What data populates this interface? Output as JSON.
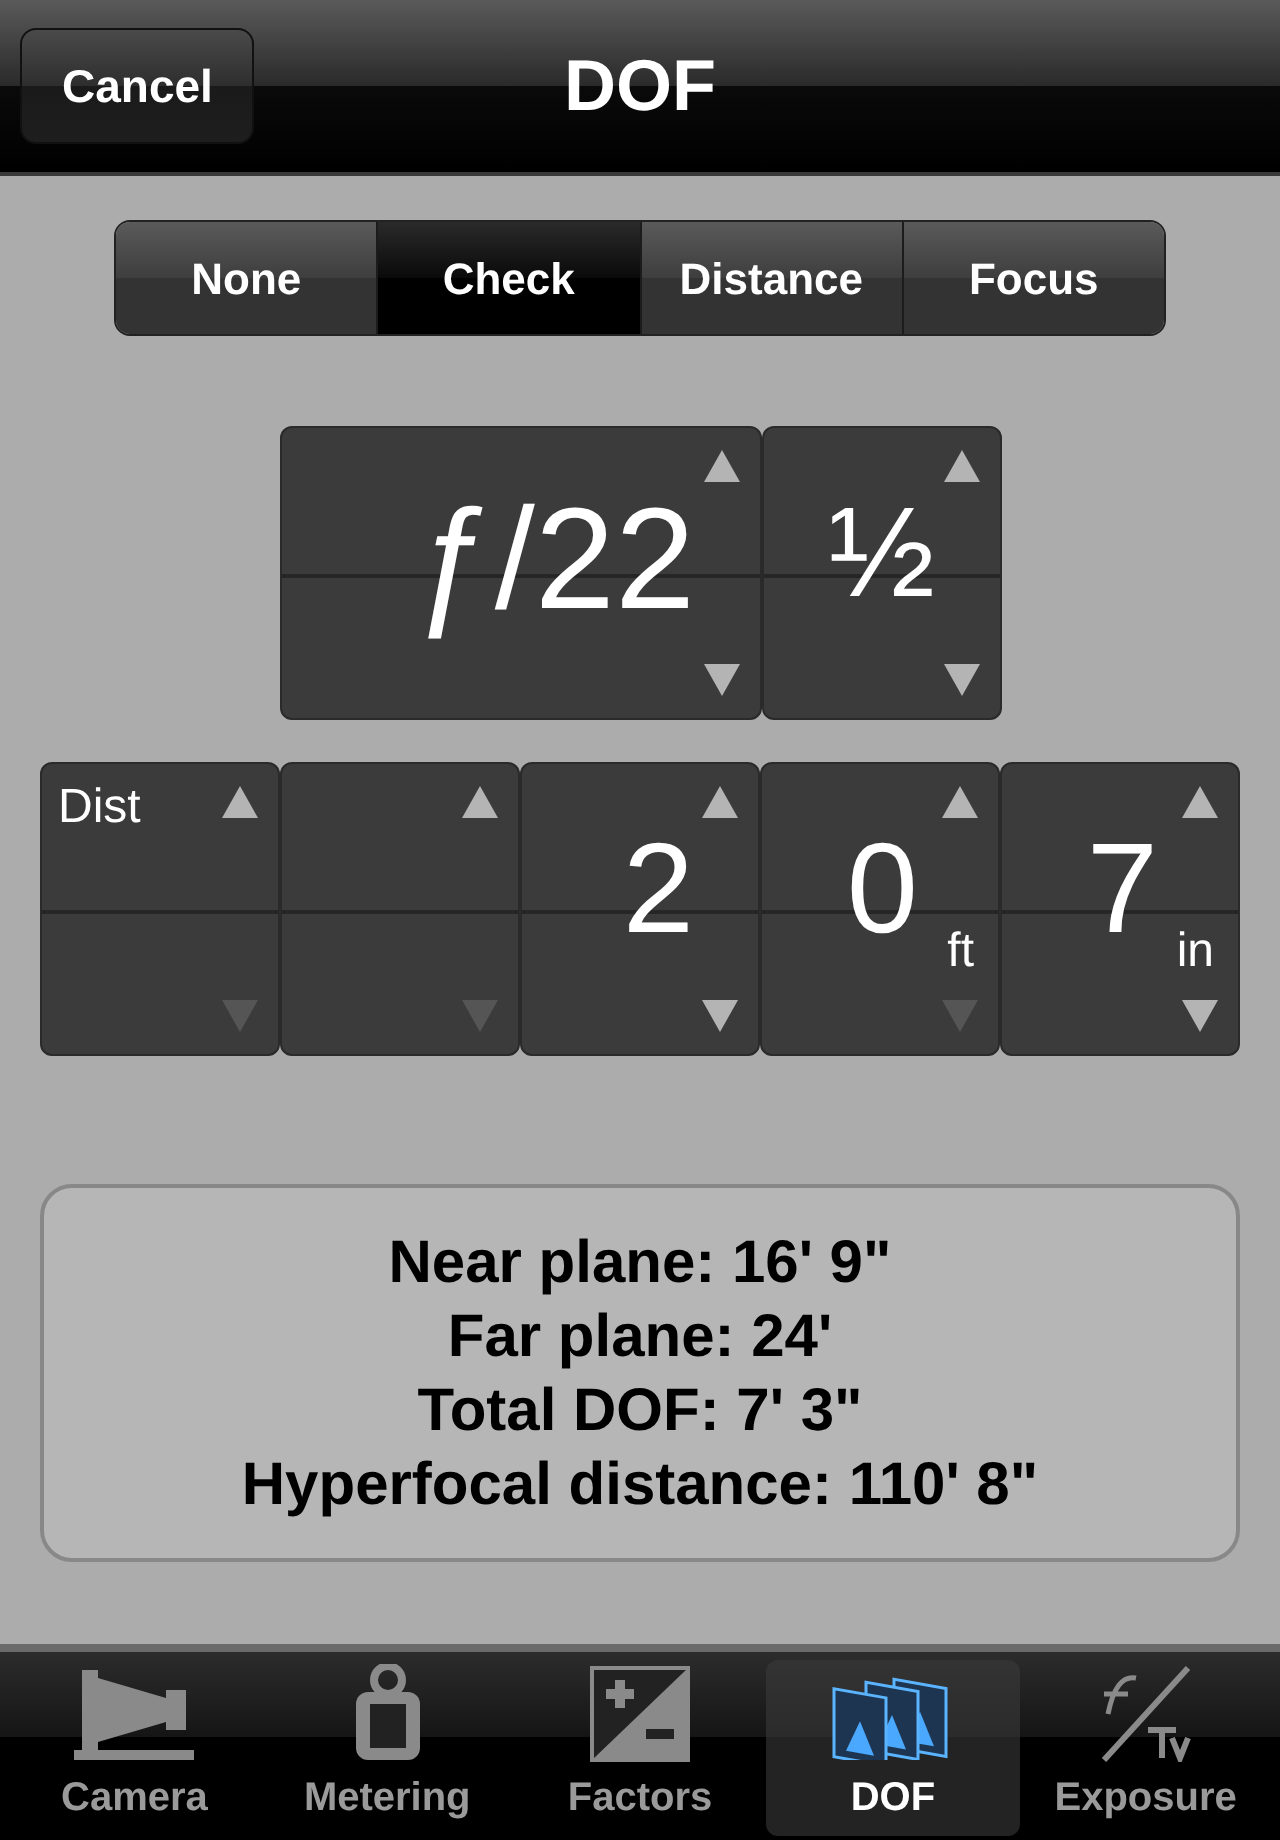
{
  "nav_bar": {
    "cancel": "Cancel",
    "title": "DOF"
  },
  "segments": [
    {
      "label": "None",
      "selected": false
    },
    {
      "label": "Check",
      "selected": true
    },
    {
      "label": "Distance",
      "selected": false
    },
    {
      "label": "Focus",
      "selected": false
    }
  ],
  "aperture_dials": [
    {
      "value": "ƒ/22",
      "up_disabled": false,
      "down_disabled": false
    },
    {
      "value": "½",
      "up_disabled": false,
      "down_disabled": false
    }
  ],
  "distance_dials": [
    {
      "label": "Dist",
      "up_disabled": false,
      "down_disabled": true
    },
    {
      "up_disabled": false,
      "down_disabled": true
    },
    {
      "value": "2",
      "up_disabled": false,
      "down_disabled": false
    },
    {
      "value": "0",
      "unit": "ft",
      "up_disabled": false,
      "down_disabled": true
    },
    {
      "value": "7",
      "unit": "in",
      "up_disabled": false,
      "down_disabled": false
    }
  ],
  "results": [
    "Near plane: 16' 9\"",
    "Far plane: 24'",
    "Total DOF: 7' 3\"",
    "Hyperfocal distance: 110' 8\""
  ],
  "tab_bar": [
    {
      "label": "Camera",
      "kind": "camera",
      "selected": false
    },
    {
      "label": "Metering",
      "kind": "meter",
      "selected": false
    },
    {
      "label": "Factors",
      "kind": "factors",
      "selected": false
    },
    {
      "label": "DOF",
      "kind": "dof",
      "selected": true
    },
    {
      "label": "Exposure",
      "kind": "exposure",
      "selected": false
    }
  ]
}
